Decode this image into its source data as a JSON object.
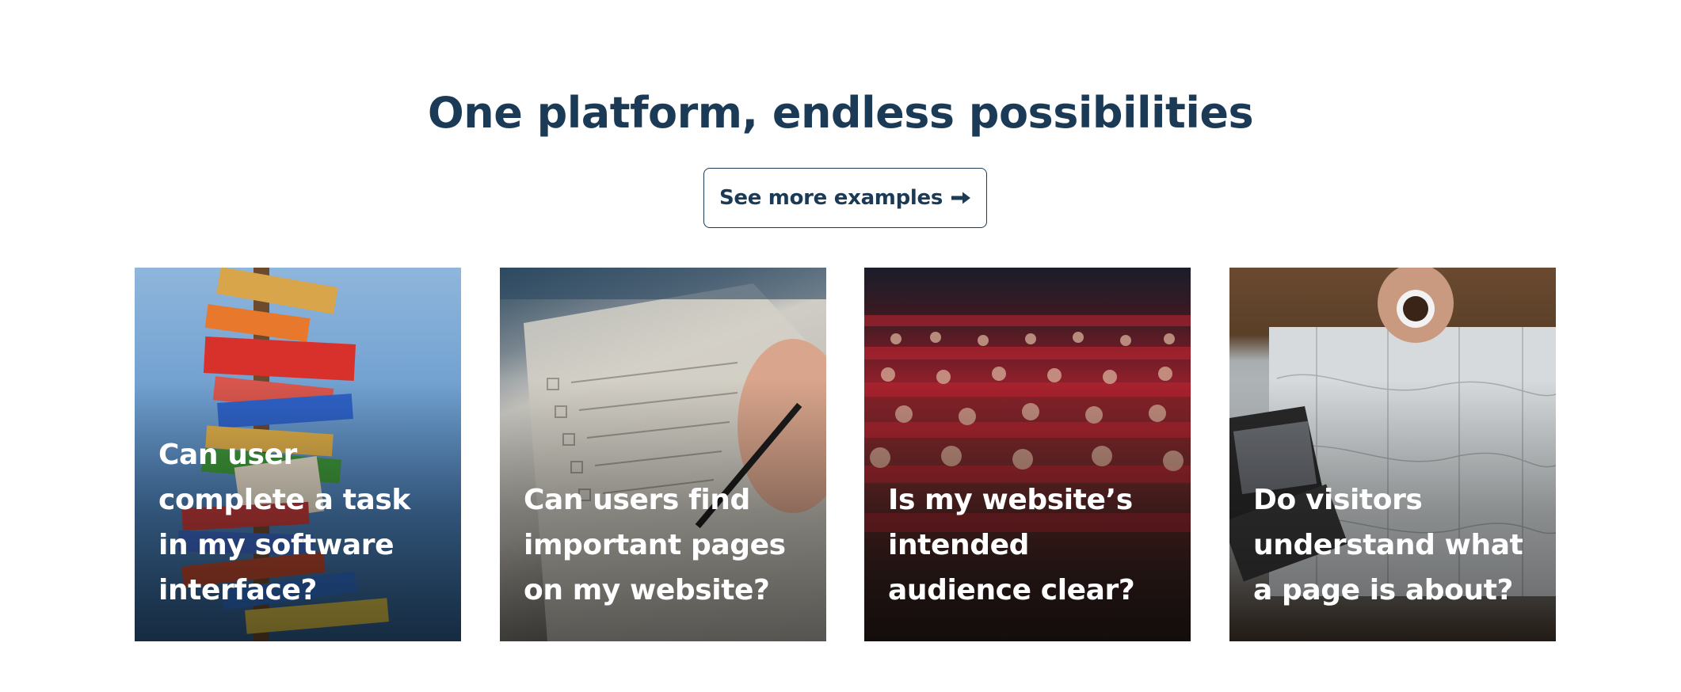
{
  "section": {
    "title": "One platform, endless possibilities",
    "cta_label": "See more examples"
  },
  "icons": {
    "cta_arrow": "arrow-right-icon"
  },
  "colors": {
    "heading": "#1b3a55",
    "cta_border": "#1b3a55",
    "card_text": "#ffffff"
  },
  "cards": [
    {
      "title": "Can user complete a task in my software interface?",
      "image": "signpost-photo"
    },
    {
      "title": "Can users find important pages on my website?",
      "image": "checklist-photo"
    },
    {
      "title": "Is my website’s intended audience clear?",
      "image": "audience-photo"
    },
    {
      "title": "Do visitors understand what a page is about?",
      "image": "map-photo"
    }
  ]
}
